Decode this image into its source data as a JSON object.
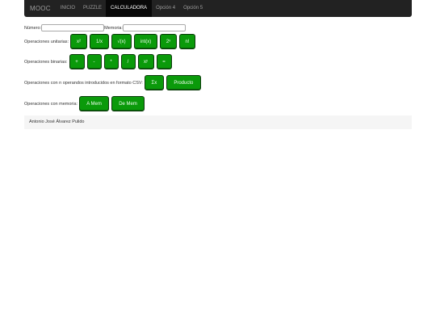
{
  "navbar": {
    "brand": "MOOC",
    "items": [
      {
        "label": "INICIO",
        "active": false
      },
      {
        "label": "PUZZLE",
        "active": false
      },
      {
        "label": "CALCULADORA",
        "active": true
      },
      {
        "label": "Opción 4",
        "active": false
      },
      {
        "label": "Opción 5",
        "active": false
      }
    ]
  },
  "inputs": {
    "numero_label": "Número:",
    "numero_value": "",
    "memoria_label": "Memoria:",
    "memoria_value": ""
  },
  "unary": {
    "label": "Operaciones unitarias:",
    "buttons": [
      "x²",
      "1/x",
      "√(x)",
      "int(x)",
      "2ˣ",
      "n!"
    ]
  },
  "binary": {
    "label": "Operaciones binarias:",
    "buttons": [
      "+",
      "-",
      "*",
      "/",
      "xʸ",
      "="
    ]
  },
  "csv": {
    "label": "Operaciones con n operandos introducidos en formato CSV:",
    "buttons": [
      "Σx",
      "Producto"
    ]
  },
  "memory": {
    "label": "Operaciones con memoria:",
    "buttons": [
      "A Mem",
      "De Mem"
    ]
  },
  "footer": {
    "author": "Antonio José Álvarez Pulido"
  },
  "colors": {
    "button_bg": "#0a9a0a",
    "navbar_bg": "#222222"
  }
}
